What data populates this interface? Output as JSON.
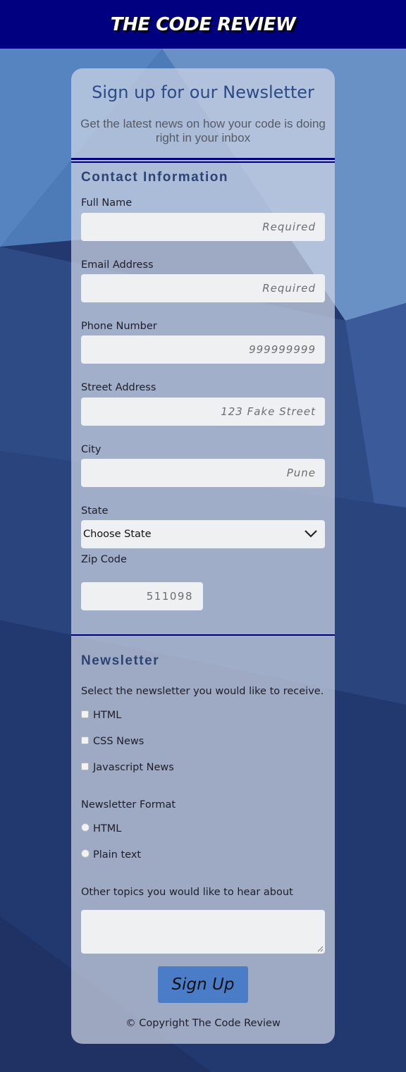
{
  "header": {
    "site_title": "THE CODE REVIEW"
  },
  "card": {
    "title": "Sign up for our Newsletter",
    "subtitle": "Get the latest news on how your code is doing right in your inbox"
  },
  "contact": {
    "heading": "Contact Information",
    "full_name": {
      "label": "Full Name",
      "placeholder": "Required"
    },
    "email": {
      "label": "Email Address",
      "placeholder": "Required"
    },
    "phone": {
      "label": "Phone Number",
      "placeholder": "999999999"
    },
    "street": {
      "label": "Street Address",
      "placeholder": "123 Fake Street"
    },
    "city": {
      "label": "City",
      "placeholder": "Pune"
    },
    "state": {
      "label": "State",
      "selected": "Choose State"
    },
    "zip": {
      "label": "Zip Code",
      "placeholder": "511098"
    }
  },
  "newsletter": {
    "heading": "Newsletter",
    "intro": "Select the newsletter you would like to receive.",
    "options": [
      "HTML",
      "CSS News",
      "Javascript News"
    ],
    "format_label": "Newsletter Format",
    "formats": [
      "HTML",
      "Plain text"
    ],
    "topics_label": "Other topics you would like to hear about"
  },
  "submit_label": "Sign Up",
  "copyright": "© Copyright The Code Review",
  "colors": {
    "header_bg": "#000080",
    "button_bg": "#4a7cc8",
    "heading": "#2c4374",
    "rule": "#000080"
  },
  "icons": {
    "state_select": "chevron-down-icon",
    "textarea_resize": "resize-grip-icon"
  }
}
